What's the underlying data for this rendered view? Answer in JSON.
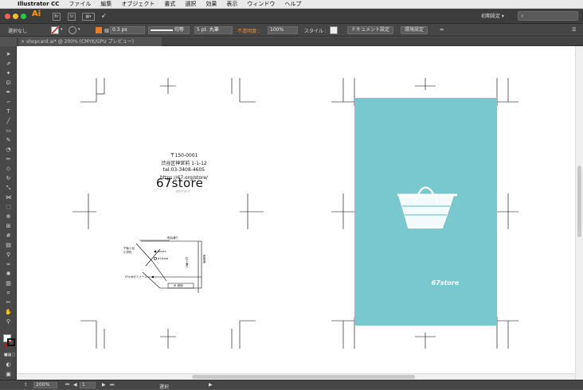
{
  "menubar": {
    "apple_icon": "apple-icon",
    "items": [
      "Illustrator CC",
      "ファイル",
      "編集",
      "オブジェクト",
      "書式",
      "選択",
      "効果",
      "表示",
      "ウィンドウ",
      "ヘルプ"
    ]
  },
  "appbar": {
    "logo": "Ai",
    "icon1": "Br",
    "icon2": "St",
    "workspace": "初期設定 ▾",
    "search_placeholder": "⌕"
  },
  "control_bar": {
    "selection": "選択なし",
    "stroke_label": "線 :",
    "stroke_weight": "0.3 px",
    "stroke_profile": "均等",
    "brush": "5 pt. 丸筆",
    "opacity_label": "不透明度 :",
    "opacity_value": "100%",
    "style_label": "スタイル :",
    "doc_setup": "ドキュメント設定",
    "prefs": "環境設定"
  },
  "document_tab": {
    "close": "×",
    "title": "shopcard.ai* @ 200% (CMYK/GPU プレビュー)"
  },
  "artboard_front": {
    "brand": "67store",
    "brand_small": "ロクナナストア",
    "address_lines": [
      "〒150-0001",
      "渋谷区神宮前 1-1-12",
      "tel:03-3408-4605",
      "https://67.org/store/"
    ],
    "map_labels": {
      "meiji_dori": "明治通り",
      "school": "千駄ヶ谷\n小学校",
      "books": "Books",
      "shop": "67store",
      "harajuku_dori": "竹下通り",
      "omotesando": "表参道",
      "yoyogi": "代々木ゼミナール",
      "station": "JR 原宿"
    }
  },
  "artboard_back": {
    "color": "#7ac8cf",
    "logo_text": "67store"
  },
  "status_bar": {
    "zoom": "200%",
    "page": "1",
    "tool_label": "選択"
  }
}
